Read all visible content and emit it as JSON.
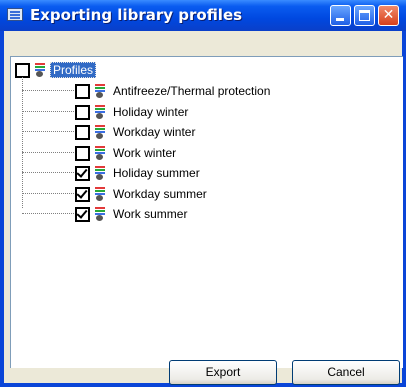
{
  "window": {
    "title": "Exporting library profiles",
    "close_glyph": "✕"
  },
  "tree": {
    "root": {
      "label": "Profiles",
      "checked": false
    },
    "items": [
      {
        "label": "Antifreeze/Thermal protection",
        "checked": false
      },
      {
        "label": "Holiday winter",
        "checked": false
      },
      {
        "label": "Workday winter",
        "checked": false
      },
      {
        "label": "Work winter",
        "checked": false
      },
      {
        "label": "Holiday summer",
        "checked": true
      },
      {
        "label": "Workday summer",
        "checked": true
      },
      {
        "label": "Work summer",
        "checked": true
      }
    ]
  },
  "buttons": {
    "export": "Export",
    "cancel": "Cancel"
  }
}
